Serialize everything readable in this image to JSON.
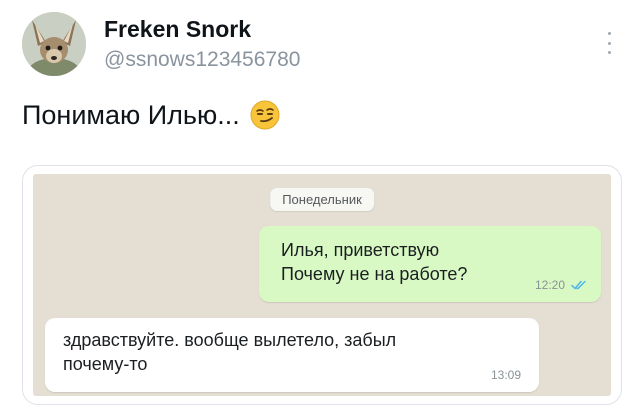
{
  "tweet": {
    "author": {
      "display_name": "Freken Snork",
      "handle": "@ssnows123456780"
    },
    "text": "Понимаю Илью...",
    "emoji": "smirking-face-emoji"
  },
  "chat_screenshot": {
    "day_label": "Понедельник",
    "outgoing_message": {
      "lines": [
        "Илья, приветствую",
        "Почему не на работе?"
      ],
      "time": "12:20",
      "status_icon": "double-check-icon"
    },
    "incoming_message": {
      "lines": [
        "здравствуйте. вообще вылетело, забыл",
        "почему-то"
      ],
      "time": "13:09"
    }
  },
  "colors": {
    "chat_background": "#e4ded3",
    "outgoing_bubble": "#d8f9c3",
    "incoming_bubble": "#ffffff",
    "read_ticks": "#4fb6ec"
  }
}
